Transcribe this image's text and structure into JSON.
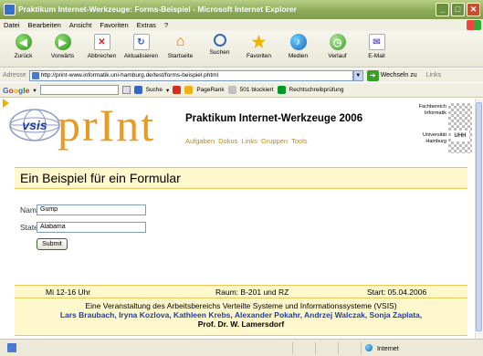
{
  "window": {
    "title": "Praktikum Internet-Werkzeuge: Forms-Beispiel - Microsoft Internet Explorer",
    "minimize": "_",
    "maximize": "□",
    "close": "✕"
  },
  "menu": [
    "Datei",
    "Bearbeiten",
    "Ansicht",
    "Favoriten",
    "Extras",
    "?"
  ],
  "toolbar": [
    {
      "label": "Zurück",
      "icon": "back-arrow-icon"
    },
    {
      "label": "Vorwärts",
      "icon": "forward-arrow-icon"
    },
    {
      "label": "Abbrechen",
      "icon": "stop-icon"
    },
    {
      "label": "Aktualisieren",
      "icon": "refresh-icon"
    },
    {
      "label": "Startseite",
      "icon": "home-icon"
    },
    {
      "label": "Suchen",
      "icon": "search-icon"
    },
    {
      "label": "Favoriten",
      "icon": "favorites-star-icon"
    },
    {
      "label": "Medien",
      "icon": "media-icon"
    },
    {
      "label": "Verlauf",
      "icon": "history-icon"
    },
    {
      "label": "E-Mail",
      "icon": "mail-icon"
    }
  ],
  "address": {
    "label": "Adresse",
    "url": "http://print-www.informatik.uni-hamburg.de/test/forms-beispiel.phtml",
    "go_label": "Wechseln zu",
    "links_label": "Links"
  },
  "google_bar": {
    "logo": "Google",
    "search_label": "Suche",
    "pagerank_label": "PageRank",
    "blocked_label": "501 blockiert",
    "spellcheck_label": "Rechtschreibprüfung"
  },
  "page": {
    "logo_text": "prInt",
    "vsis_text": "vsis",
    "course_title": "Praktikum Internet-Werkzeuge 2006",
    "nav": [
      "Aufgaben",
      "Dokus",
      "Links",
      "Gruppen",
      "Tools"
    ],
    "faculty_line1": "Fachbereich",
    "faculty_line2": "Informatik",
    "uni_line1": "Universität",
    "uni_line2": "Hamburg",
    "uhh": "UHH",
    "headline": "Ein Beispiel für ein Formular",
    "form": {
      "name_label": "Name:",
      "name_value": "Gump",
      "state_label": "State:",
      "state_value": "Alabama",
      "submit_label": "Submit"
    },
    "info": {
      "time": "Mi 12-16 Uhr",
      "room": "Raum: B-201 und RZ",
      "start": "Start: 05.04.2006"
    },
    "footer": {
      "line1": "Eine Veranstaltung des Arbeitsbereichs Verteilte Systeme und Informationssysteme (VSIS)",
      "names": "Lars Braubach, Iryna Kozlova, Kathleen Krebs, Alexander Pokahr, Andrzej Walczak, Sonja Zaplata,",
      "prof": "Prof. Dr. W. Lamersdorf"
    }
  },
  "status": {
    "zone": "Internet"
  }
}
